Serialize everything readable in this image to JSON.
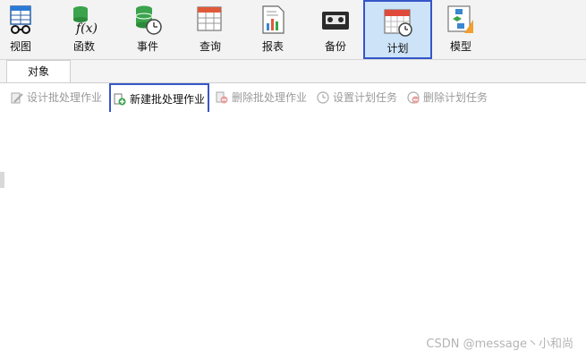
{
  "ribbon": {
    "items": [
      {
        "label": "视图",
        "icon": "view-icon"
      },
      {
        "label": "函数",
        "icon": "function-icon"
      },
      {
        "label": "事件",
        "icon": "event-icon"
      },
      {
        "label": "查询",
        "icon": "query-icon"
      },
      {
        "label": "报表",
        "icon": "report-icon"
      },
      {
        "label": "备份",
        "icon": "backup-icon"
      },
      {
        "label": "计划",
        "icon": "schedule-icon",
        "active": true
      },
      {
        "label": "模型",
        "icon": "model-icon"
      }
    ]
  },
  "tabs": {
    "objects": "对象"
  },
  "toolbar": {
    "design": "设计批处理作业",
    "new": "新建批处理作业",
    "delete": "删除批处理作业",
    "set_schedule": "设置计划任务",
    "delete_schedule": "删除计划任务"
  },
  "watermark": "CSDN @message丶小和尚",
  "colors": {
    "highlight": "#3556c8",
    "active_bg": "#cde3f7"
  }
}
